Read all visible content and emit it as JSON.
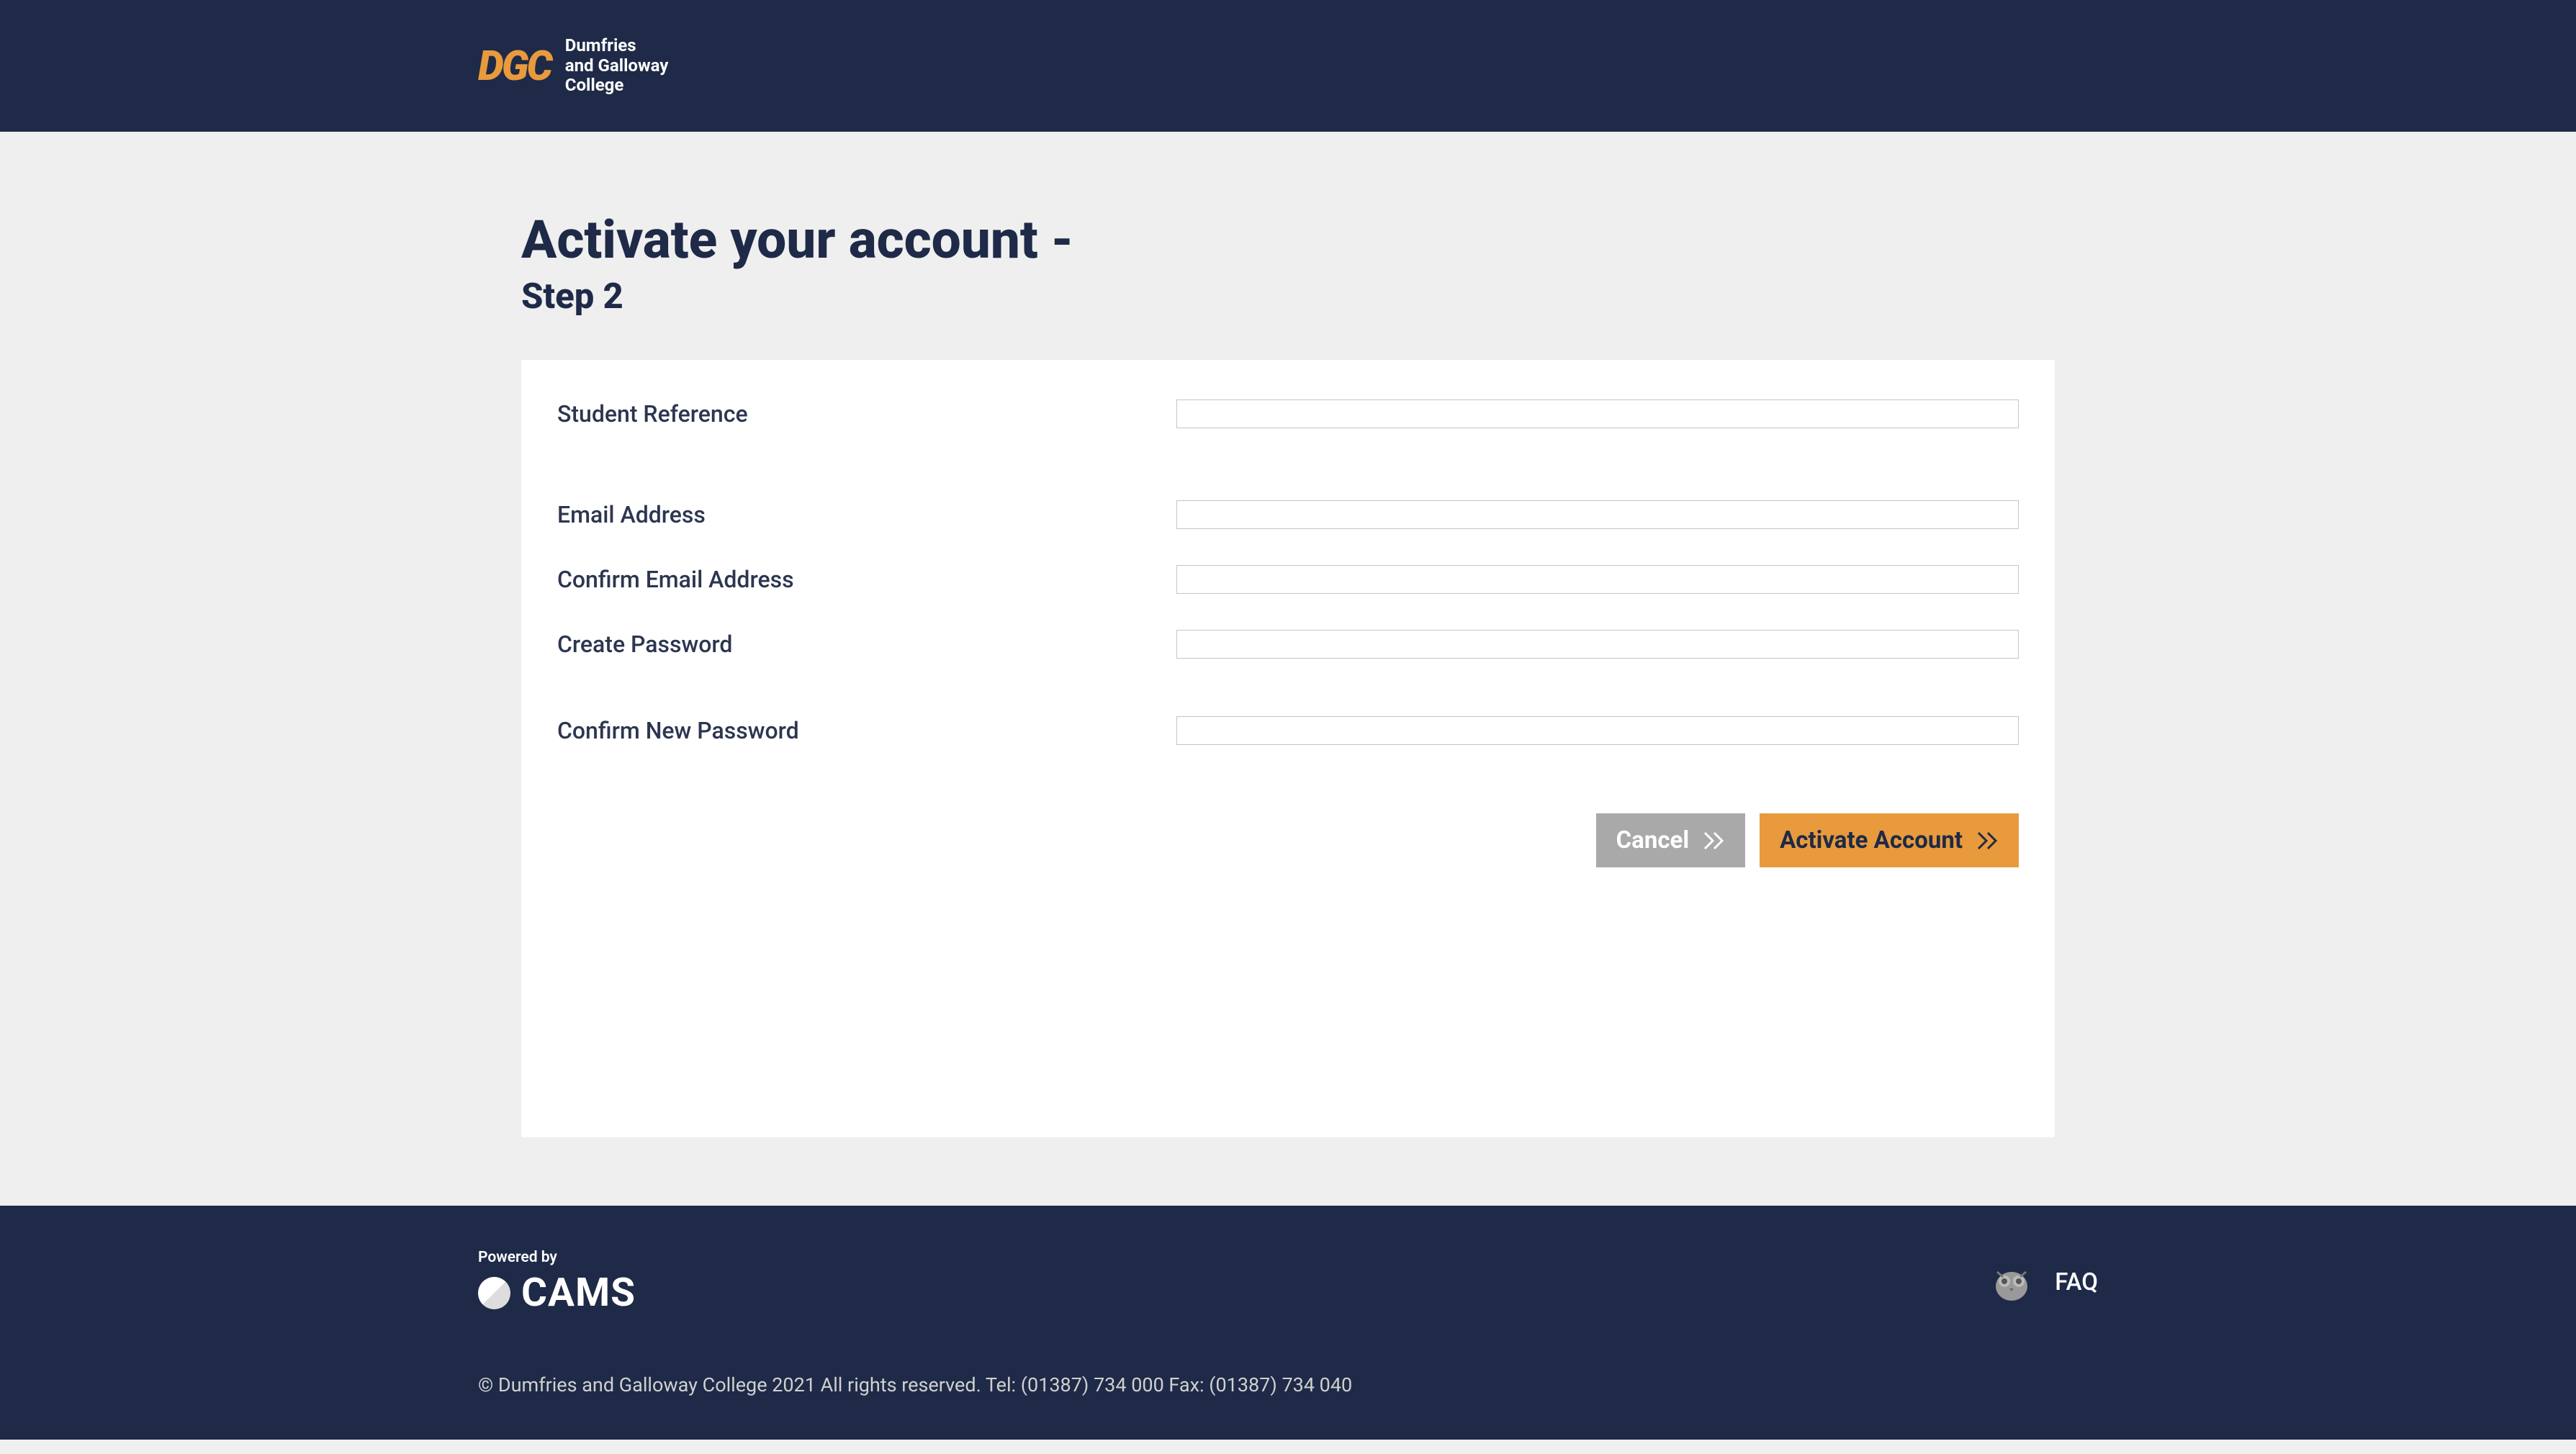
{
  "header": {
    "logo_mark": "DGC",
    "logo_text_line1": "Dumfries",
    "logo_text_line2": "and Galloway",
    "logo_text_line3": "College"
  },
  "page": {
    "title": "Activate your account -",
    "subtitle": "Step 2"
  },
  "form": {
    "student_reference_label": "Student Reference",
    "student_reference_value": "",
    "email_label": "Email Address",
    "email_value": "",
    "confirm_email_label": "Confirm Email Address",
    "confirm_email_value": "",
    "password_label": "Create Password",
    "password_value": "",
    "confirm_password_label": "Confirm New Password",
    "confirm_password_value": ""
  },
  "buttons": {
    "cancel_label": "Cancel",
    "activate_label": "Activate Account"
  },
  "footer": {
    "powered_by_label": "Powered by",
    "cams_text": "CAMS",
    "faq_label": "FAQ",
    "copyright": "© Dumfries and Galloway College 2021 All rights reserved. Tel: (01387) 734 000 Fax: (01387) 734 040"
  }
}
